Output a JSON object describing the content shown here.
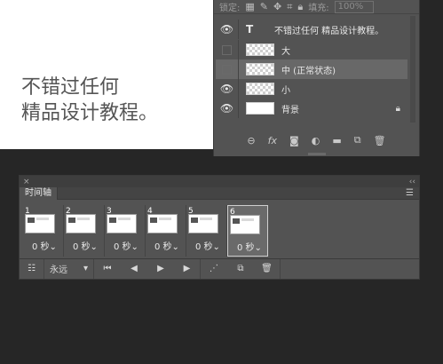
{
  "canvas": {
    "line1": "不错过任何",
    "line2": "精品设计教程。"
  },
  "layers_panel": {
    "lock_label": "锁定:",
    "fill_label": "填充:",
    "fill_value": "100%",
    "layers": [
      {
        "name": "不错过任何 精品设计教程。",
        "visible": true,
        "type": "text"
      },
      {
        "name": "大",
        "visible": false,
        "type": "image"
      },
      {
        "name": "中 (正常状态)",
        "visible": false,
        "type": "image",
        "selected": true
      },
      {
        "name": "小",
        "visible": true,
        "type": "image"
      },
      {
        "name": "背景",
        "visible": true,
        "type": "background",
        "locked": true
      }
    ],
    "footer_icons": [
      "link-icon",
      "fx-icon",
      "mask-icon",
      "adjustment-icon",
      "folder-icon",
      "new-layer-icon",
      "trash-icon"
    ],
    "fx_label": "fx"
  },
  "timeline": {
    "title": "时间轴",
    "frames": [
      {
        "number": "1",
        "delay": "0 秒"
      },
      {
        "number": "2",
        "delay": "0 秒"
      },
      {
        "number": "3",
        "delay": "0 秒"
      },
      {
        "number": "4",
        "delay": "0 秒"
      },
      {
        "number": "5",
        "delay": "0 秒"
      },
      {
        "number": "6",
        "delay": "0 秒",
        "selected": true
      }
    ],
    "loop_value": "永远"
  }
}
